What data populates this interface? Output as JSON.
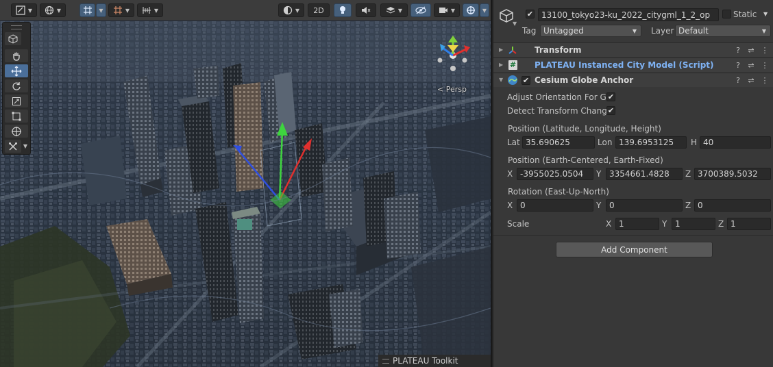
{
  "scene": {
    "toolbar": {
      "draw_mode_icon": "shading-icon",
      "view_2d_label": "2D",
      "light_icon": "bulb-icon",
      "audio_icon": "audio-icon",
      "effects_icon": "effects-icon",
      "hidden_icon": "visibility-icon",
      "camera_icon": "camera-icon",
      "gizmos_icon": "gizmo-icon"
    },
    "persp_label": "< Persp",
    "overlay_title": "PLATEAU Toolkit",
    "tools": [
      "hand-icon",
      "move-icon",
      "rotate-icon",
      "scale-icon",
      "rect-icon",
      "transform-icon",
      "custom-tool-icon"
    ]
  },
  "inspector": {
    "object_name": "13100_tokyo23-ku_2022_citygml_1_2_op",
    "object_active": true,
    "static_label": "Static",
    "tag_label": "Tag",
    "tag_value": "Untagged",
    "layer_label": "Layer",
    "layer_value": "Default",
    "components": [
      {
        "name": "Transform",
        "icon": "transform-axes-icon",
        "expanded": false
      },
      {
        "name": "PLATEAU Instanced City Model (Script)",
        "icon": "script-hash-icon",
        "expanded": false
      },
      {
        "name": "Cesium Globe Anchor",
        "icon": "cesium-globe-icon",
        "expanded": true,
        "enabled": true
      }
    ],
    "cesium": {
      "adjust_orientation_label": "Adjust Orientation For Glo",
      "adjust_orientation": true,
      "detect_transform_label": "Detect Transform Change",
      "detect_transform": true,
      "position_llh_label": "Position (Latitude, Longitude, Height)",
      "lat_label": "Lat",
      "lat": "35.690625",
      "lon_label": "Lon",
      "lon": "139.6953125",
      "h_label": "H",
      "h": "40",
      "position_ecef_label": "Position (Earth-Centered, Earth-Fixed)",
      "ecef_x_label": "X",
      "ecef_x": "-3955025.0504",
      "ecef_y_label": "Y",
      "ecef_y": "3354661.4828",
      "ecef_z_label": "Z",
      "ecef_z": "3700389.5032",
      "rotation_label": "Rotation (East-Up-North)",
      "rot_x_label": "X",
      "rot_x": "0",
      "rot_y_label": "Y",
      "rot_y": "0",
      "rot_z_label": "Z",
      "rot_z": "0",
      "scale_label": "Scale",
      "scale_x_label": "X",
      "scale_x": "1",
      "scale_y_label": "Y",
      "scale_y": "1",
      "scale_z_label": "Z",
      "scale_z": "1"
    },
    "add_component_label": "Add Component"
  }
}
